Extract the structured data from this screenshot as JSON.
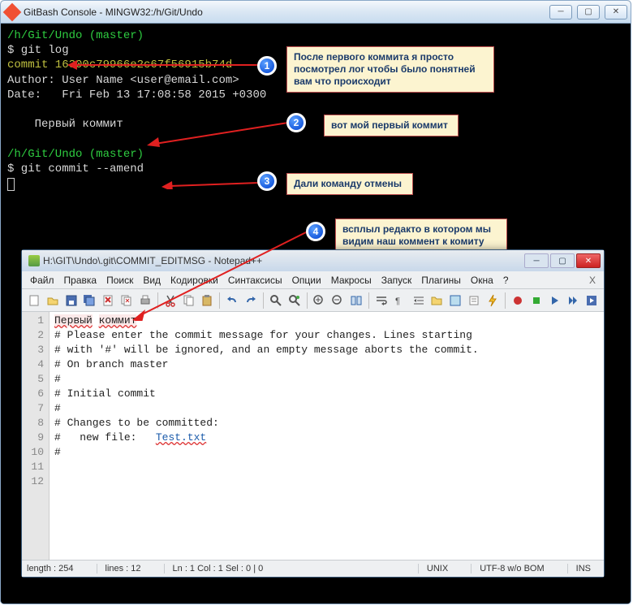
{
  "outer_window": {
    "title": "GitBash Console - MINGW32:/h/Git/Undo"
  },
  "terminal": {
    "path1": "/h/Git/Undo (master)",
    "cmd1": "$ git log",
    "commit": "commit 16300c79966e2c67f56915b74d",
    "author": "Author: User Name <user@email.com>",
    "date": "Date:   Fri Feb 13 17:08:58 2015 +0300",
    "msg": "    Первый коммит",
    "path2": "/h/Git/Undo (master)",
    "cmd2": "$ git commit --amend"
  },
  "callouts": {
    "c1": "После первого коммита я просто посмотрел лог чтобы было понятней вам что происходит",
    "c2": "вот мой первый коммит",
    "c3": "Дали команду отмены",
    "c4": "всплыл редакто в котором мы видим наш коммент к комиту"
  },
  "npp": {
    "title": "H:\\GIT\\Undo\\.git\\COMMIT_EDITMSG - Notepad++",
    "menus": [
      "Файл",
      "Правка",
      "Поиск",
      "Вид",
      "Кодировки",
      "Синтаксисы",
      "Опции",
      "Макросы",
      "Запуск",
      "Плагины",
      "Окна",
      "?"
    ],
    "lines": [
      "Первый коммит",
      "",
      "# Please enter the commit message for your changes. Lines starting",
      "# with '#' will be ignored, and an empty message aborts the commit.",
      "# On branch master",
      "#",
      "# Initial commit",
      "#",
      "# Changes to be committed:",
      "#   new file:   Test.txt",
      "#",
      ""
    ],
    "status": {
      "length": "length : 254",
      "lines": "lines : 12",
      "pos": "Ln : 1   Col : 1   Sel : 0 | 0",
      "os": "UNIX",
      "enc": "UTF-8 w/o BOM",
      "mode": "INS"
    }
  }
}
